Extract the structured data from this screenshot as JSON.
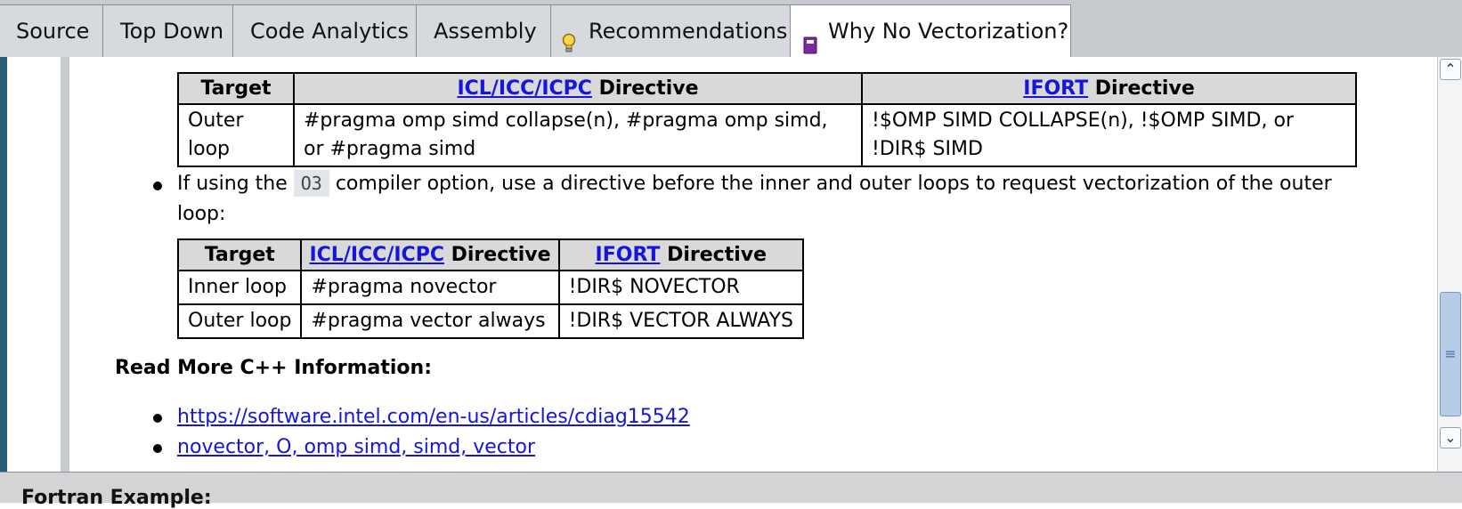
{
  "tabs": [
    {
      "label": "Source"
    },
    {
      "label": "Top Down"
    },
    {
      "label": "Code Analytics"
    },
    {
      "label": "Assembly"
    },
    {
      "label": "Recommendations",
      "icon": "lightbulb-icon"
    },
    {
      "label": "Why No Vectorization?",
      "icon": "book-icon"
    }
  ],
  "table1": {
    "headers": {
      "target": "Target",
      "icl_link": "ICL/ICC/ICPC",
      "icl_suffix": " Directive",
      "ifort_link": "IFORT",
      "ifort_suffix": " Directive"
    },
    "rows": [
      {
        "target": "Outer loop",
        "icl": "#pragma omp simd collapse(n), #pragma omp simd, or #pragma simd",
        "ifort": "!$OMP SIMD COLLAPSE(n), !$OMP SIMD, or !DIR$ SIMD"
      }
    ]
  },
  "bullet1": {
    "prefix": "If using the ",
    "code": "O3",
    "suffix": " compiler option, use a directive before the inner and outer loops to request vectorization of the outer",
    "line2": "loop:"
  },
  "table2": {
    "headers": {
      "target": "Target",
      "icl_link": "ICL/ICC/ICPC",
      "icl_suffix": " Directive",
      "ifort_link": "IFORT",
      "ifort_suffix": " Directive"
    },
    "rows": [
      {
        "target": "Inner loop",
        "icl": "#pragma novector",
        "ifort": "!DIR$ NOVECTOR"
      },
      {
        "target": "Outer loop",
        "icl": "#pragma vector always",
        "ifort": "!DIR$ VECTOR ALWAYS"
      }
    ]
  },
  "read_more": {
    "heading": "Read More C++ Information:",
    "links": [
      "https://software.intel.com/en-us/articles/cdiag15542",
      "novector, O, omp simd, simd, vector"
    ]
  },
  "footer_heading": "Fortran Example:",
  "colors": {
    "link": "#1515dd",
    "table_header": "#d9d9d9",
    "tab_strip": "#c7cbd0",
    "left_strip": "#2a5f7c"
  }
}
